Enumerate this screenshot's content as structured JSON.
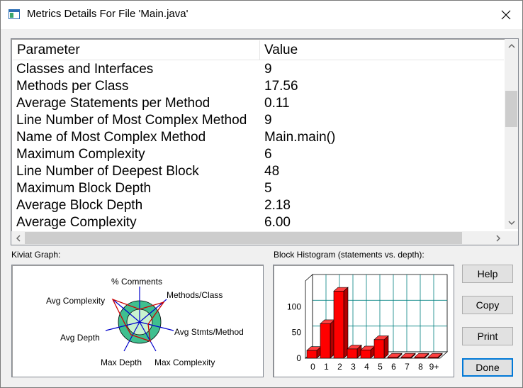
{
  "window": {
    "title": "Metrics Details For File 'Main.java'"
  },
  "table": {
    "headers": {
      "parameter": "Parameter",
      "value": "Value"
    },
    "rows": [
      {
        "parameter": "Classes and Interfaces",
        "value": "9"
      },
      {
        "parameter": "Methods per Class",
        "value": "17.56"
      },
      {
        "parameter": "Average Statements per Method",
        "value": "0.11"
      },
      {
        "parameter": "Line Number of Most Complex Method",
        "value": "9"
      },
      {
        "parameter": "Name of Most Complex Method",
        "value": "Main.main()"
      },
      {
        "parameter": "Maximum Complexity",
        "value": "6"
      },
      {
        "parameter": "Line Number of Deepest Block",
        "value": "48"
      },
      {
        "parameter": "Maximum Block Depth",
        "value": "5"
      },
      {
        "parameter": "Average Block Depth",
        "value": "2.18"
      },
      {
        "parameter": "Average Complexity",
        "value": "6.00"
      }
    ]
  },
  "kiviat": {
    "label": "Kiviat Graph:",
    "axes": [
      "% Comments",
      "Methods/Class",
      "Avg Stmts/Method",
      "Max Complexity",
      "Max Depth",
      "Avg Depth",
      "Avg Complexity"
    ]
  },
  "histogram": {
    "label": "Block Histogram (statements vs. depth):"
  },
  "buttons": {
    "help": "Help",
    "copy": "Copy",
    "print": "Print",
    "done": "Done"
  },
  "chart_data": {
    "type": "bar",
    "title": "Block Histogram (statements vs. depth):",
    "categories": [
      "0",
      "1",
      "2",
      "3",
      "4",
      "5",
      "6",
      "7",
      "8",
      "9+"
    ],
    "values": [
      15,
      67,
      130,
      18,
      16,
      36,
      2,
      2,
      2,
      2
    ],
    "yticks": [
      "0",
      "50",
      "100"
    ],
    "ylim": [
      0,
      150
    ],
    "bar_color": "#ff0000"
  }
}
